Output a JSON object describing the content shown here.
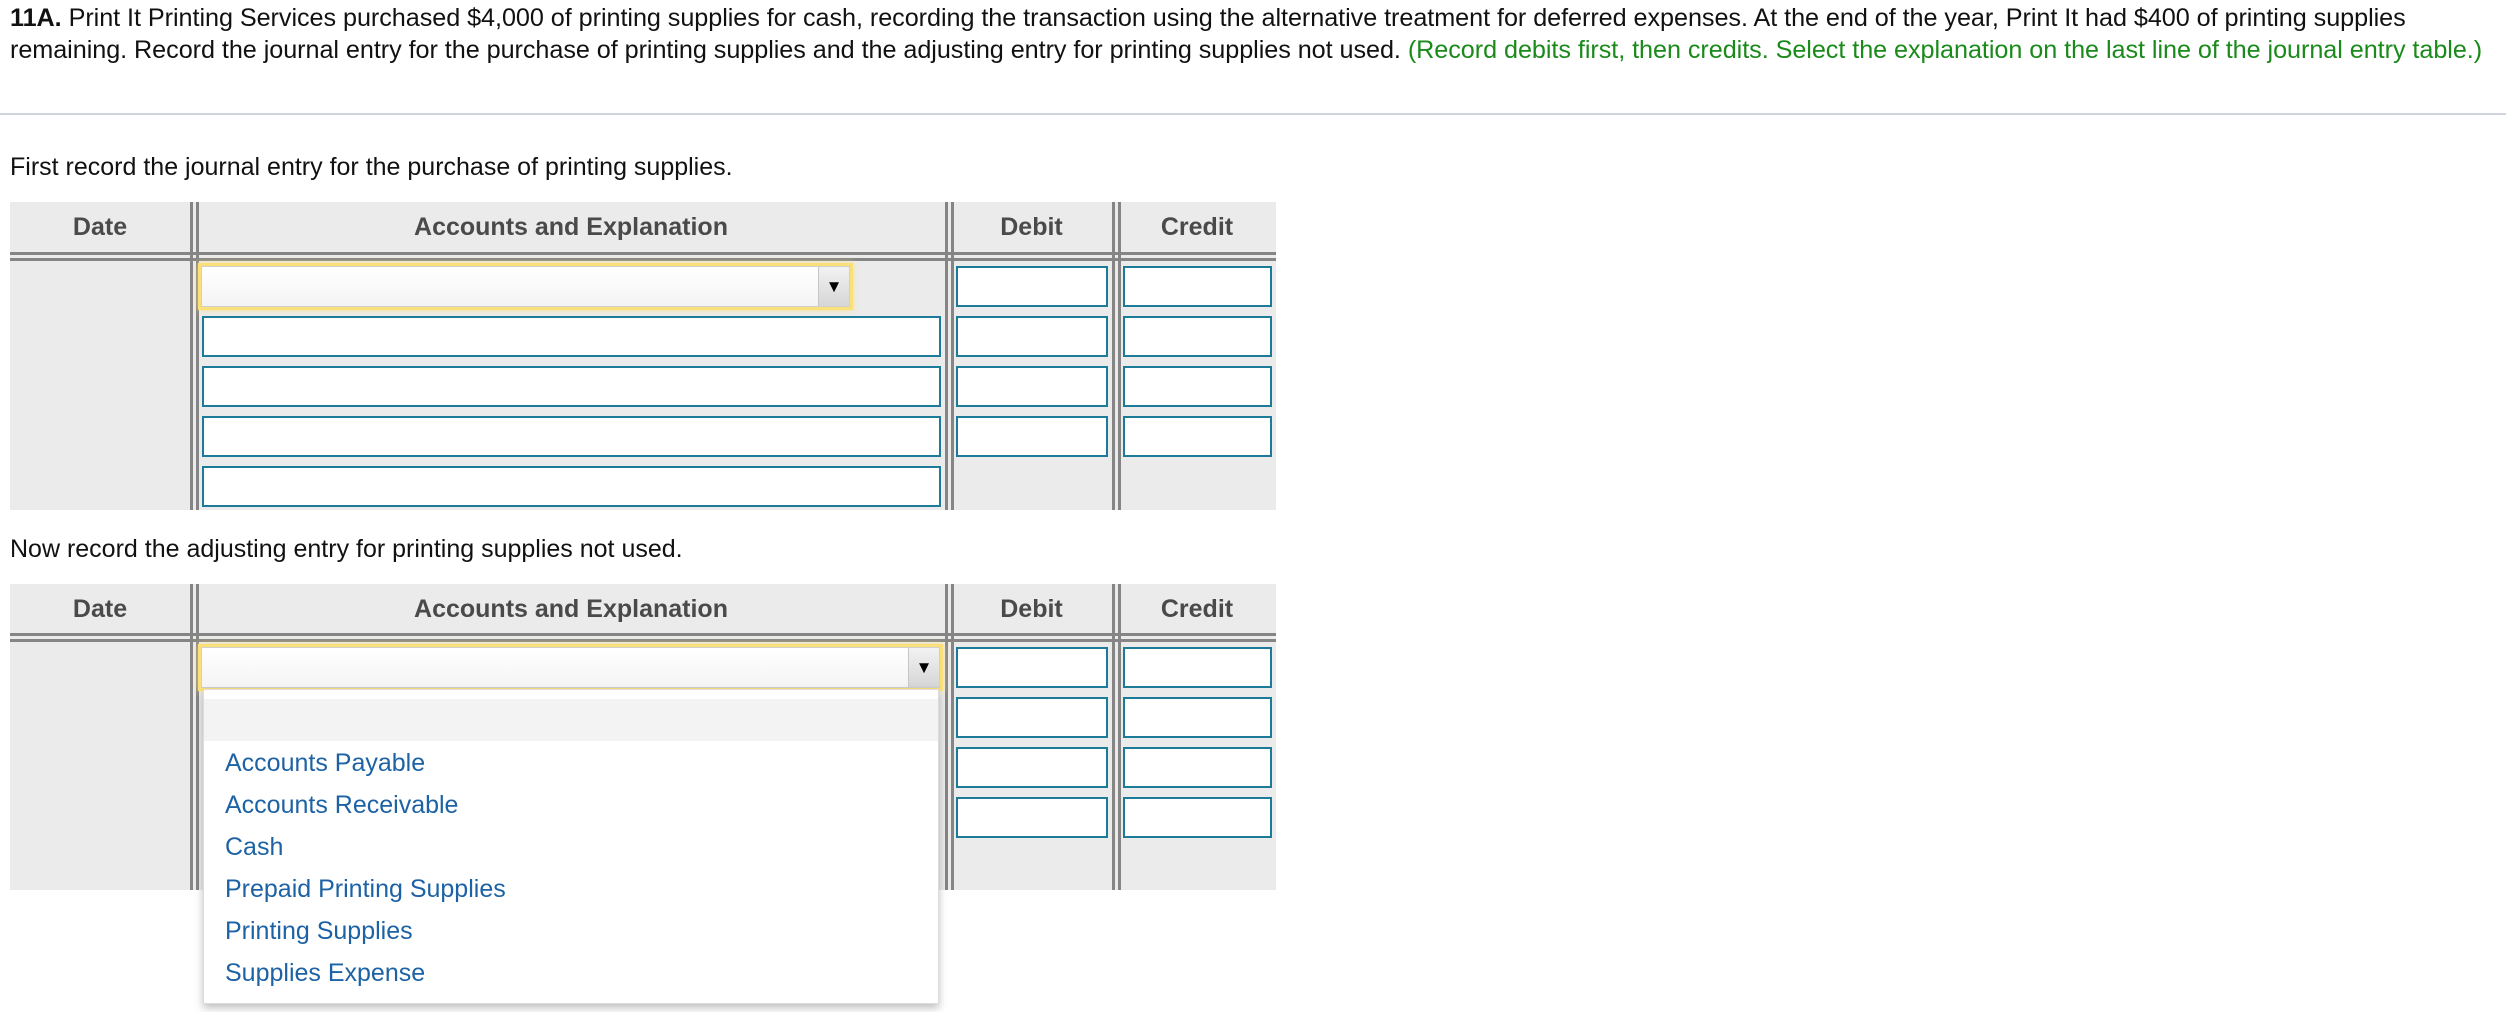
{
  "question": {
    "number": "11A.",
    "text": " Print It Printing Services purchased $4,000 of printing supplies for cash, recording the transaction using the alternative treatment for deferred expenses. At the end of the year, Print It had $400 of printing supplies remaining. Record the journal entry for the purchase of printing supplies and the adjusting entry for printing supplies not used. ",
    "hint": "(Record debits first, then credits. Select the explanation on the last line of the journal entry table.)"
  },
  "entry1": {
    "instruction": "First record the journal entry for the purchase of printing supplies.",
    "headers": {
      "date": "Date",
      "accounts": "Accounts and Explanation",
      "debit": "Debit",
      "credit": "Credit"
    },
    "account_select_value": "",
    "account_rows": [
      "",
      "",
      "",
      ""
    ],
    "debit_values": [
      "",
      "",
      "",
      ""
    ],
    "credit_values": [
      "",
      "",
      "",
      ""
    ],
    "arrow_icon": "▼"
  },
  "entry2": {
    "instruction": "Now record the adjusting entry for printing supplies not used.",
    "headers": {
      "date": "Date",
      "accounts": "Accounts and Explanation",
      "debit": "Debit",
      "credit": "Credit"
    },
    "account_select_value": "",
    "debit_values": [
      "",
      "",
      "",
      ""
    ],
    "credit_values": [
      "",
      "",
      "",
      ""
    ],
    "arrow_icon": "▼",
    "dropdown_open": true,
    "dropdown_options": [
      "",
      "Accounts Payable",
      "Accounts Receivable",
      "Cash",
      "Prepaid Printing Supplies",
      "Printing Supplies",
      "Supplies Expense"
    ]
  },
  "colors": {
    "hint_green": "#1a8a1a",
    "input_border": "#1b7b99",
    "option_blue": "#1d62a4",
    "focus_yellow": "#fbe07a",
    "table_bg": "#ebebeb"
  }
}
